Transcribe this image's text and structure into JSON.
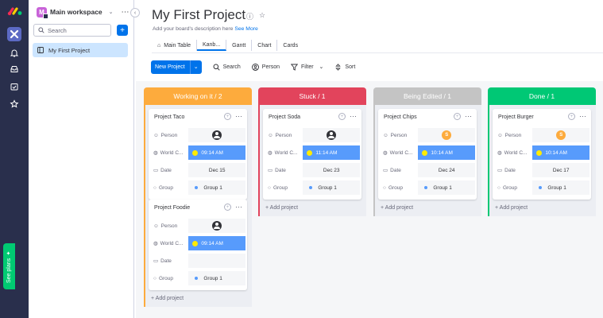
{
  "workspace": {
    "avatar_letter": "M",
    "name": "Main workspace",
    "search_placeholder": "Search",
    "add_label": "+",
    "items": [
      {
        "label": "My First Project"
      }
    ]
  },
  "rail": {
    "see_plans": "See plans",
    "icons": [
      "monday-logo",
      "workspace-icon",
      "bell-icon",
      "inbox-icon",
      "my-work-icon",
      "star-icon"
    ]
  },
  "board": {
    "title": "My First Project",
    "description": "Add your board's description here",
    "see_more": "See More",
    "tabs": [
      {
        "label": "Main Table",
        "active": false
      },
      {
        "label": "Kanb...",
        "active": true
      },
      {
        "label": "Gantt",
        "active": false
      },
      {
        "label": "Chart",
        "active": false
      },
      {
        "label": "Cards",
        "active": false
      }
    ],
    "toolbar": {
      "new_project": "New Project",
      "search": "Search",
      "person": "Person",
      "filter": "Filter",
      "sort": "Sort"
    }
  },
  "field_labels": {
    "person": "Person",
    "world_clock": "World C...",
    "date": "Date",
    "group": "Group"
  },
  "add_project_label": "+ Add project",
  "colors": {
    "working": "#fdab3d",
    "stuck": "#e2445c",
    "editing": "#c4c4c4",
    "done": "#00c875",
    "accent": "#0073ea",
    "clock_cell": "#579bfc"
  },
  "columns": [
    {
      "title": "Working on it / 2",
      "color": "#fdab3d",
      "cards": [
        {
          "name": "Project Taco",
          "person": "black-avatar",
          "time": "09:14 AM",
          "date": "Dec 15",
          "group": "Group 1"
        },
        {
          "name": "Project Foodie",
          "person": "black-avatar",
          "time": "09:14 AM",
          "date": "",
          "group": "Group 1"
        }
      ]
    },
    {
      "title": "Stuck / 1",
      "color": "#e2445c",
      "cards": [
        {
          "name": "Project Soda",
          "person": "black-avatar",
          "time": "11:14 AM",
          "date": "Dec 23",
          "group": "Group 1"
        }
      ]
    },
    {
      "title": "Being Edited / 1",
      "color": "#c4c4c4",
      "cards": [
        {
          "name": "Project Chips",
          "person_initial": "S",
          "time": "10:14 AM",
          "date": "Dec 24",
          "group": "Group 1"
        }
      ]
    },
    {
      "title": "Done / 1",
      "color": "#00c875",
      "cards": [
        {
          "name": "Project Burger",
          "person_initial": "S",
          "time": "10:14 AM",
          "date": "Dec 17",
          "group": "Group 1"
        }
      ]
    }
  ]
}
